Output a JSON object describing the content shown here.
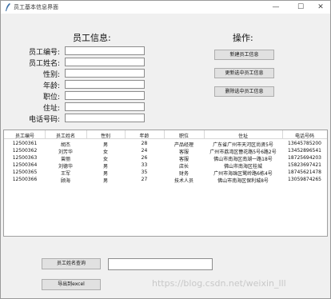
{
  "window": {
    "title": "员工基本信息界面",
    "minimize": "—",
    "maximize": "☐",
    "close": "✕"
  },
  "form": {
    "header": "员工信息:",
    "fields": [
      {
        "label": "员工编号:",
        "value": ""
      },
      {
        "label": "员工姓名:",
        "value": ""
      },
      {
        "label": "性别:",
        "value": ""
      },
      {
        "label": "年龄:",
        "value": ""
      },
      {
        "label": "职位:",
        "value": ""
      },
      {
        "label": "住址:",
        "value": ""
      },
      {
        "label": "电话号码:",
        "value": ""
      }
    ]
  },
  "operations": {
    "header": "操作:",
    "buttons": [
      "新建员工信息",
      "更新选中员工信息",
      "删除选中员工信息"
    ]
  },
  "table": {
    "columns": [
      "员工编号",
      "员工姓名",
      "性别",
      "年龄",
      "职位",
      "住址",
      "电话号码"
    ],
    "rows": [
      [
        "12500361",
        "胡杰",
        "男",
        "28",
        "产品经理",
        "广东省广州市天河区尚贤5号",
        "13645785200"
      ],
      [
        "12500362",
        "刘芳华",
        "女",
        "24",
        "客服",
        "广州市荔湾区簪花路5号6路2号",
        "13452896541"
      ],
      [
        "12500363",
        "曾丽",
        "女",
        "26",
        "客服",
        "佛山市南海区南湖一路18号",
        "18725694203"
      ],
      [
        "12500364",
        "刘德华",
        "男",
        "33",
        "店长",
        "佛山市南海区桂城",
        "15823697421"
      ],
      [
        "12500365",
        "王军",
        "男",
        "35",
        "财务",
        "广州市海珠区鹭岭路6栋4号",
        "18745621478"
      ],
      [
        "12500366",
        "顾海",
        "男",
        "27",
        "技术人员",
        "佛山市南海区保利城8号",
        "13059874265"
      ]
    ]
  },
  "bottom": {
    "query_button": "员工姓名查询",
    "query_value": "",
    "export_button": "导出到excel"
  },
  "watermark": "https://blog.csdn.net/weixin_lll"
}
